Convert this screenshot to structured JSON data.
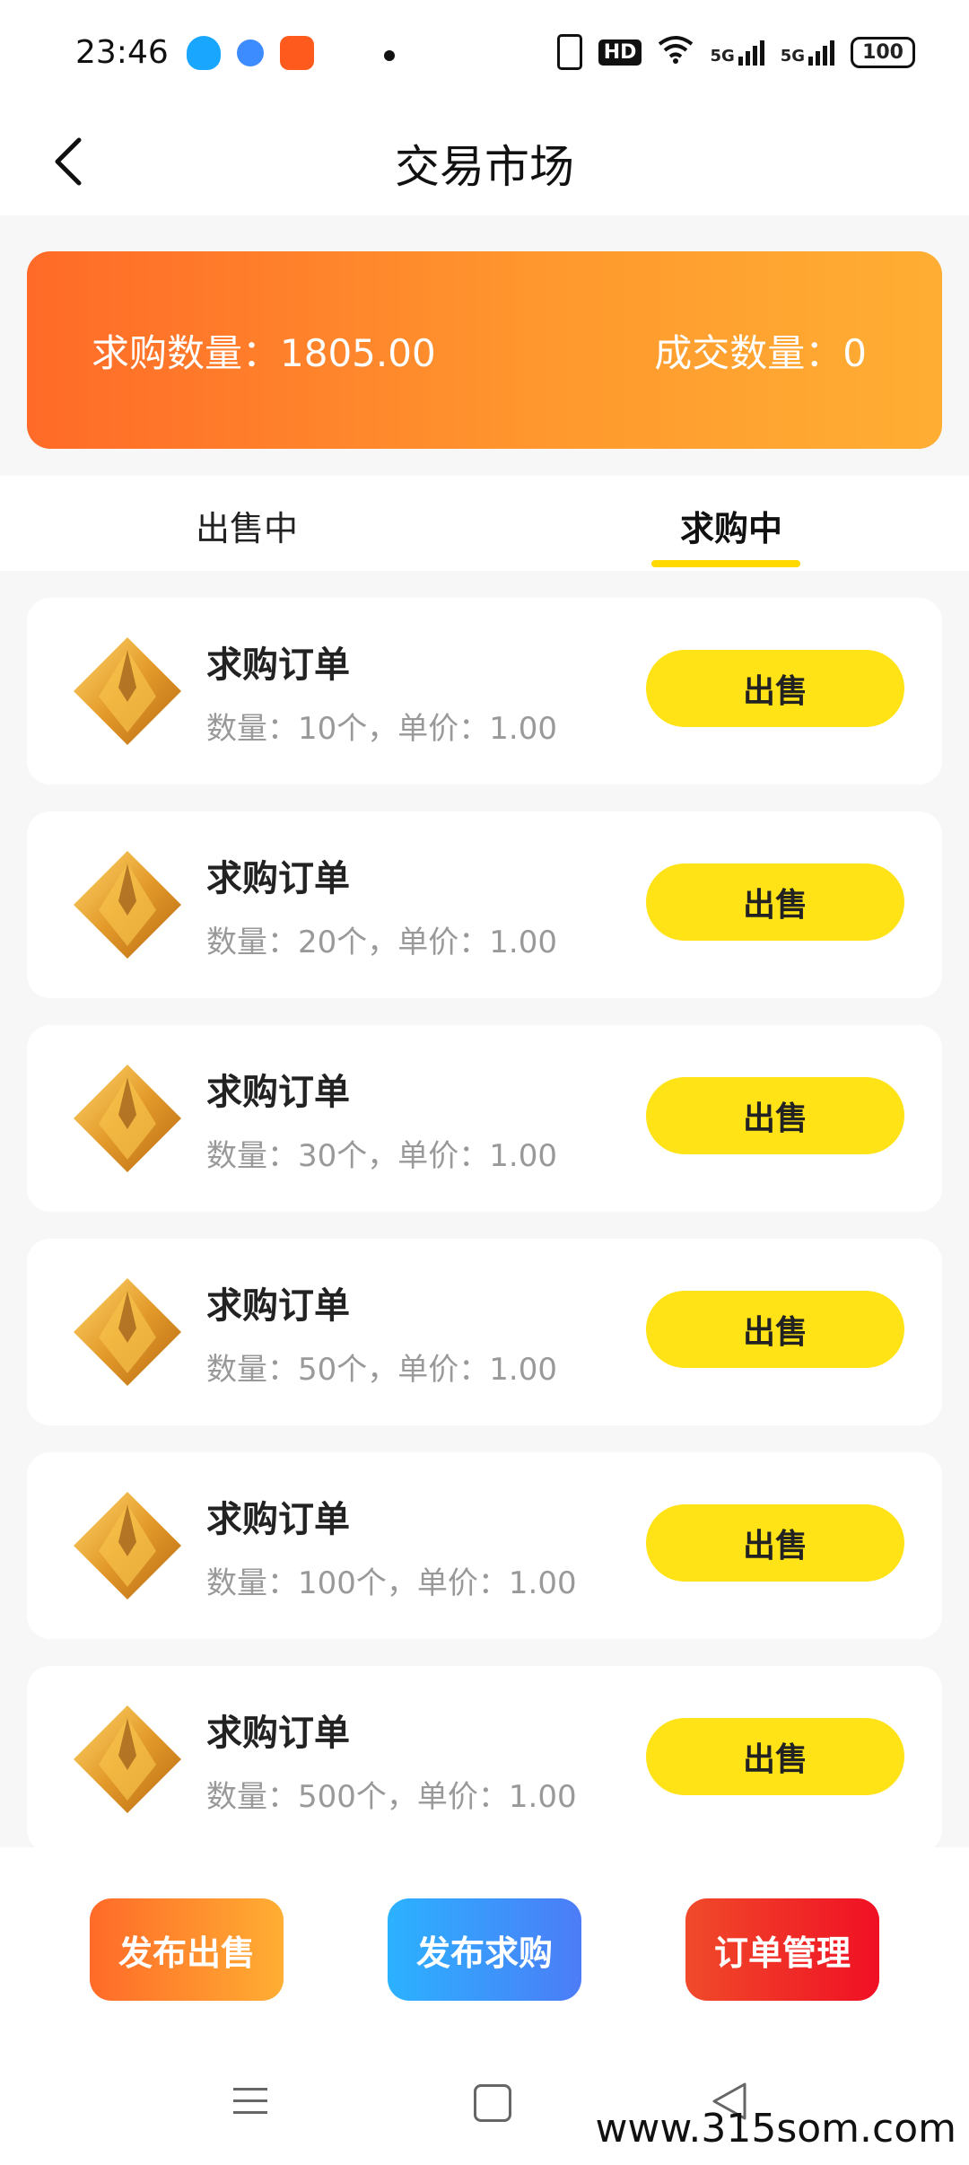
{
  "status_bar": {
    "time": "23:46",
    "icons": [
      "qq-icon",
      "bluebird-icon",
      "video-app-icon",
      "vibrate-icon",
      "hd-icon",
      "wifi-icon",
      "5g-signal-icon",
      "5g-signal-icon"
    ],
    "hd_label": "HD",
    "signal_label_1": "5G",
    "signal_label_2": "5G",
    "battery": "100"
  },
  "header": {
    "title": "交易市场"
  },
  "summary": {
    "buy_quantity": "求购数量：1805.00",
    "deal_quantity": "成交数量：0"
  },
  "tabs": [
    {
      "label": "出售中",
      "selected": false
    },
    {
      "label": "求购中",
      "selected": true
    }
  ],
  "orders": [
    {
      "title": "求购订单",
      "desc": "数量：10个，单价：1.00",
      "button": "出售"
    },
    {
      "title": "求购订单",
      "desc": "数量：20个，单价：1.00",
      "button": "出售"
    },
    {
      "title": "求购订单",
      "desc": "数量：30个，单价：1.00",
      "button": "出售"
    },
    {
      "title": "求购订单",
      "desc": "数量：50个，单价：1.00",
      "button": "出售"
    },
    {
      "title": "求购订单",
      "desc": "数量：100个，单价：1.00",
      "button": "出售"
    },
    {
      "title": "求购订单",
      "desc": "数量：500个，单价：1.00",
      "button": "出售"
    }
  ],
  "actions": {
    "publish_sell": "发布出售",
    "publish_buy": "发布求购",
    "order_manage": "订单管理"
  },
  "watermark": "www.315som.com",
  "colors": {
    "accent_yellow": "#ffe316",
    "orange_start": "#ff6a28",
    "orange_end": "#ffae33",
    "blue_start": "#2bb2ff",
    "blue_end": "#4c7cf7",
    "red_start": "#f04a2a",
    "red_end": "#f01024"
  }
}
